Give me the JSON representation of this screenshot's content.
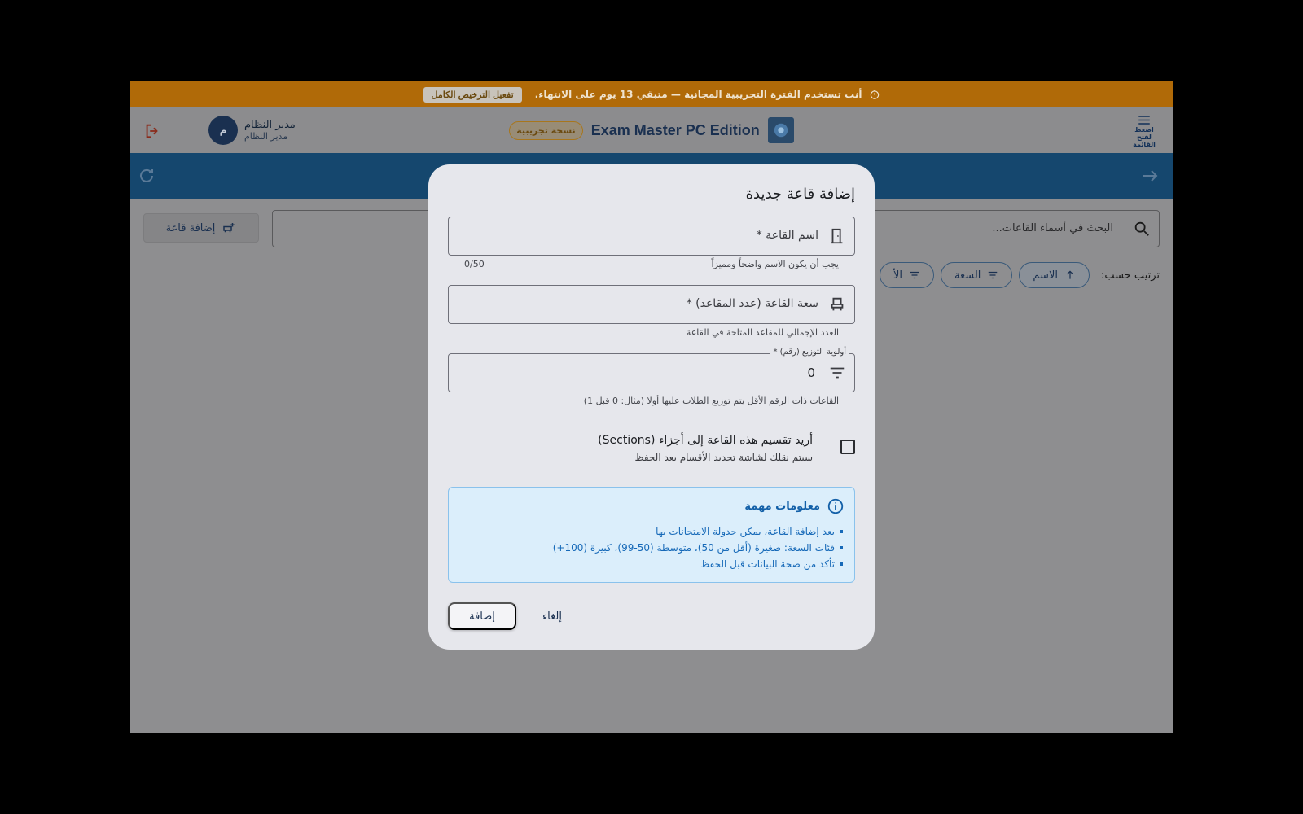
{
  "trial": {
    "message": "أنت تستخدم الفترة التجريبية المجانية — متبقي 13 يوم على الانتهاء.",
    "activate_label": "تفعيل الترخيص الكامل"
  },
  "header": {
    "menu_label": "اضغط لفتح القائمة",
    "app_title": "Exam Master PC Edition",
    "trial_badge": "نسخة تجريبية",
    "user": {
      "initial": "م",
      "name": "مدير النظام",
      "role": "مدير النظام"
    }
  },
  "page": {
    "add_room_label": "إضافة قاعة",
    "search_placeholder": "البحث في أسماء القاعات...",
    "sort_label": "ترتيب حسب:",
    "sort_options": [
      "الاسم",
      "السعة",
      "الأ"
    ]
  },
  "dialog": {
    "title": "إضافة قاعة جديدة",
    "name_field": {
      "label": "اسم القاعة *",
      "helper": "يجب أن يكون الاسم واضحاً ومميزاً",
      "counter": "0/50"
    },
    "capacity_field": {
      "label": "سعة القاعة (عدد المقاعد) *",
      "helper": "العدد الإجمالي للمقاعد المتاحة في القاعة"
    },
    "priority_field": {
      "label": "أولوية التوزيع (رقم) *",
      "value": "0",
      "helper": "القاعات ذات الرقم الأقل يتم توزيع الطلاب عليها أولا (مثال: 0 قبل 1)"
    },
    "sections": {
      "title": "أريد تقسيم هذه القاعة إلى أجزاء (Sections)",
      "subtitle": "سيتم نقلك لشاشة تحديد الأقسام بعد الحفظ",
      "checked": false
    },
    "info": {
      "title": "معلومات مهمة",
      "items": [
        "بعد إضافة القاعة، يمكن جدولة الامتحانات بها",
        "فئات السعة: صغيرة (أقل من 50)، متوسطة (50-99)، كبيرة (100+)",
        "تأكد من صحة البيانات قبل الحفظ"
      ]
    },
    "add_label": "إضافة",
    "cancel_label": "إلغاء"
  },
  "colors": {
    "accent": "#1669b8",
    "trial_bar": "#b06a08",
    "toolbar": "#15476e"
  }
}
